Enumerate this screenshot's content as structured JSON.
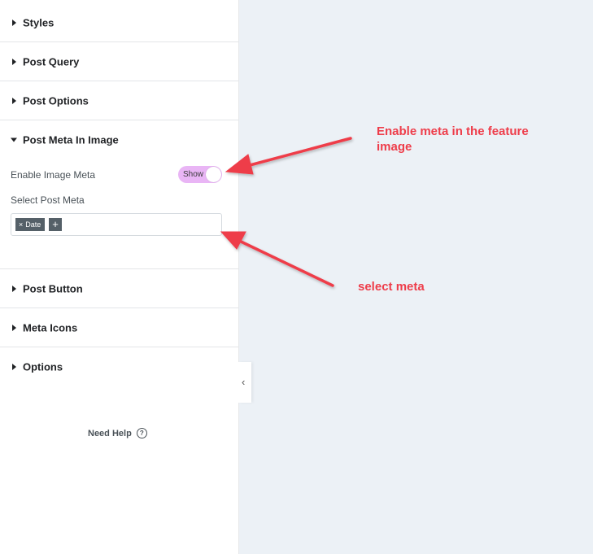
{
  "sections": {
    "styles": "Styles",
    "post_query": "Post Query",
    "post_options": "Post Options",
    "post_meta_in_image": "Post Meta In Image",
    "post_button": "Post Button",
    "meta_icons": "Meta Icons",
    "options": "Options"
  },
  "post_meta_in_image": {
    "enable_label": "Enable Image Meta",
    "toggle_text": "Show",
    "toggle_state": "on",
    "select_label": "Select Post Meta",
    "selected_tags": [
      "Date"
    ],
    "tag_remove_glyph": "×",
    "add_glyph": "+"
  },
  "footer": {
    "help_text": "Need Help",
    "help_icon_glyph": "?"
  },
  "collapse_glyph": "‹",
  "annotations": {
    "enable_meta": "Enable meta in the feature image",
    "select_meta": "select meta"
  },
  "colors": {
    "annotation": "#ee3d4a",
    "toggle_on": "#e9b5f5",
    "canvas_bg": "#ecf1f6"
  }
}
